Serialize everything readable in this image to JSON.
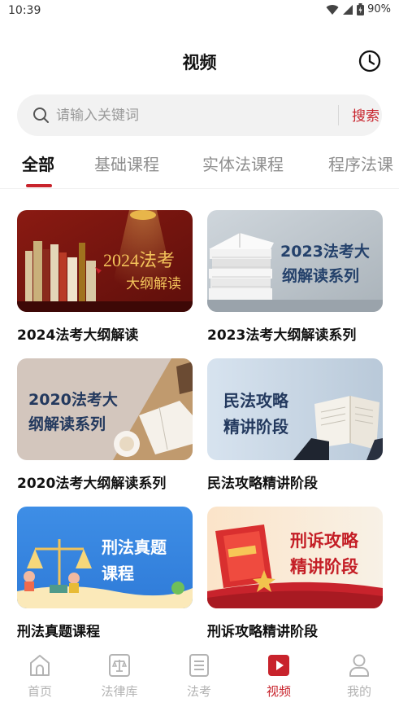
{
  "status_bar": {
    "time": "10:39",
    "battery": "90%"
  },
  "header": {
    "title": "视频",
    "history_icon": "clock-icon"
  },
  "search": {
    "placeholder": "请输入关键词",
    "button": "搜索"
  },
  "tabs": [
    {
      "label": "全部",
      "active": true
    },
    {
      "label": "基础课程",
      "active": false
    },
    {
      "label": "实体法课程",
      "active": false
    },
    {
      "label": "程序法课",
      "active": false
    }
  ],
  "courses": [
    {
      "title": "2024法考大纲解读",
      "banner_line1": "2024法考",
      "banner_line2": "大纲解读"
    },
    {
      "title": "2023法考大纲解读系列",
      "banner_line1": "2023法考大",
      "banner_line2": "纲解读系列"
    },
    {
      "title": "2020法考大纲解读系列",
      "banner_line1": "2020法考大",
      "banner_line2": "纲解读系列"
    },
    {
      "title": "民法攻略精讲阶段",
      "banner_line1": "民法攻略",
      "banner_line2": "精讲阶段"
    },
    {
      "title": "刑法真题课程",
      "banner_line1": "刑法真题",
      "banner_line2": "课程"
    },
    {
      "title": "刑诉攻略精讲阶段",
      "banner_line1": "刑诉攻略",
      "banner_line2": "精讲阶段"
    }
  ],
  "bottom_nav": [
    {
      "label": "首页",
      "icon": "home-icon",
      "active": false
    },
    {
      "label": "法律库",
      "icon": "scales-icon",
      "active": false
    },
    {
      "label": "法考",
      "icon": "document-icon",
      "active": false
    },
    {
      "label": "视频",
      "icon": "play-icon",
      "active": true
    },
    {
      "label": "我的",
      "icon": "person-icon",
      "active": false
    }
  ],
  "colors": {
    "accent": "#c8232c",
    "inactive": "#b3b3b3",
    "search_bg": "#f2f2f2"
  }
}
